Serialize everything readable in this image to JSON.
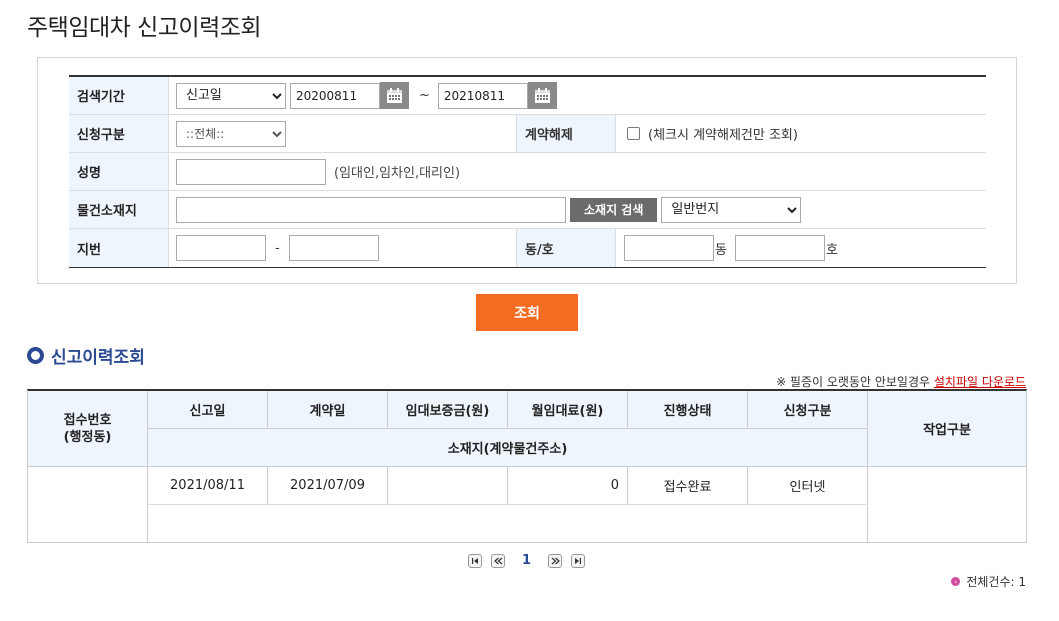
{
  "page": {
    "title": "주택임대차 신고이력조회"
  },
  "search": {
    "period_label": "검색기간",
    "date_type_selected": "신고일",
    "date_from": "20200811",
    "tilde": "~",
    "date_to": "20210811",
    "apply_type_label": "신청구분",
    "apply_type_selected": "::전체::",
    "termination_label": "계약해제",
    "termination_hint": "(체크시 계약해제건만 조회)",
    "name_label": "성명",
    "name_value": "",
    "name_hint": "(임대인,임차인,대리인)",
    "address_label": "물건소재지",
    "address_value": "",
    "address_search_btn": "소재지 검색",
    "lot_type_selected": "일반번지",
    "lot_label": "지번",
    "lot_dash": "-",
    "dongho_label": "동/호",
    "dong_suffix": "동",
    "ho_suffix": "호",
    "query_btn": "조회"
  },
  "section": {
    "title": "신고이력조회"
  },
  "notice": {
    "text": "※ 필증이 오랫동안 안보일경우 ",
    "link": "설치파일 다운로드"
  },
  "result": {
    "headers": {
      "receipt_no": "접수번호",
      "receipt_no_sub": "(행정동)",
      "report_date": "신고일",
      "contract_date": "계약일",
      "deposit": "임대보증금(원)",
      "monthly_rent": "월임대료(원)",
      "status": "진행상태",
      "apply_type": "신청구분",
      "address": "소재지(계약물건주소)",
      "work": "작업구분"
    },
    "rows": [
      {
        "receipt_no": "",
        "report_date": "2021/08/11",
        "contract_date": "2021/07/09",
        "deposit": "",
        "monthly_rent": "0",
        "status": "접수완료",
        "apply_type": "인터넷",
        "address": "",
        "work": ""
      }
    ]
  },
  "pager": {
    "current": "1"
  },
  "total": {
    "label": "전체건수: 1"
  },
  "colors": {
    "accent": "#f46b21",
    "header_bg": "#eef5fc",
    "brand_blue": "#2b4a93"
  }
}
